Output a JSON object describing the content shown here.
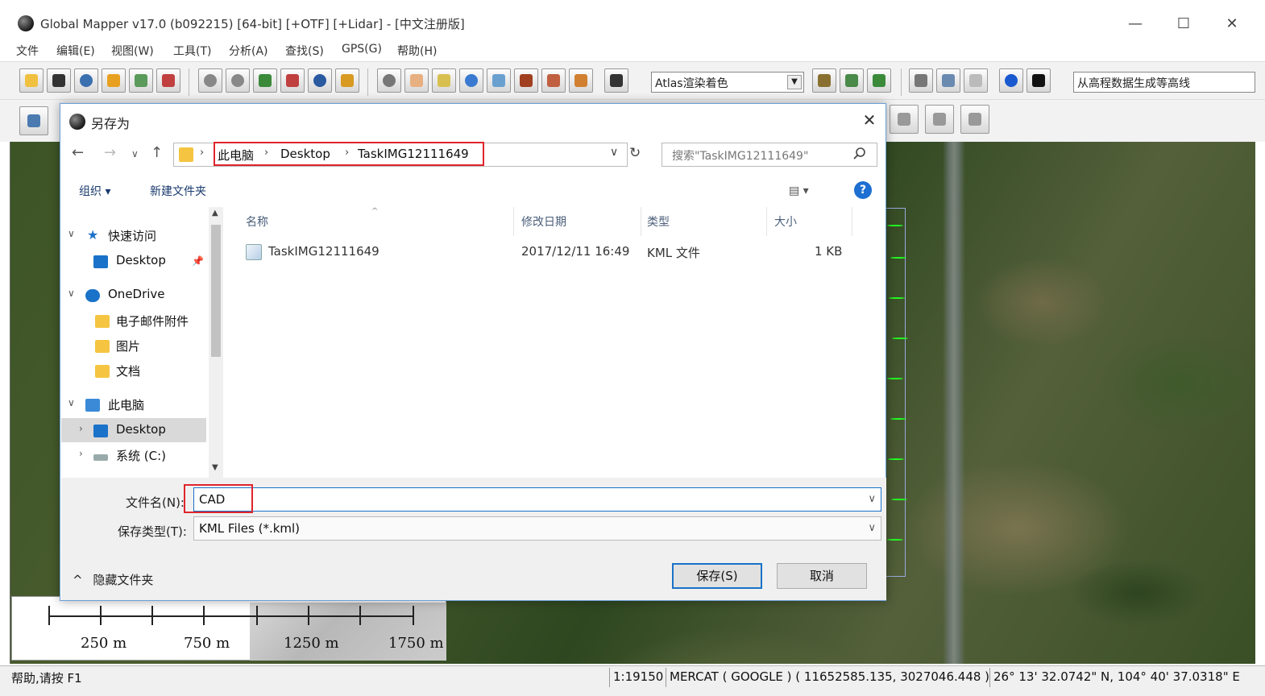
{
  "window": {
    "title": "Global Mapper v17.0 (b092215) [64-bit] [+OTF] [+Lidar] - [中文注册版]",
    "minimize": "—",
    "maximize": "☐",
    "close": "✕"
  },
  "menu": [
    "文件",
    "编辑(E)",
    "视图(W)",
    "工具(T)",
    "分析(A)",
    "查找(S)",
    "GPS(G)",
    "帮助(H)"
  ],
  "toolbar": {
    "shader_combo": "Atlas渲染着色",
    "contour_combo": "从高程数据生成等高线"
  },
  "dialog": {
    "title": "另存为",
    "breadcrumb": [
      "此电脑",
      "Desktop",
      "TaskIMG12111649"
    ],
    "search_placeholder": "搜索\"TaskIMG12111649\"",
    "commands": {
      "organize": "组织 ▾",
      "new_folder": "新建文件夹"
    },
    "nav": [
      {
        "label": "快速访问"
      },
      {
        "label": "Desktop"
      },
      {
        "label": "OneDrive"
      },
      {
        "label": "电子邮件附件"
      },
      {
        "label": "图片"
      },
      {
        "label": "文档"
      },
      {
        "label": "此电脑"
      },
      {
        "label": "Desktop"
      },
      {
        "label": "系统 (C:)"
      }
    ],
    "columns": {
      "name": "名称",
      "date": "修改日期",
      "type": "类型",
      "size": "大小"
    },
    "files": [
      {
        "name": "TaskIMG12111649",
        "date": "2017/12/11 16:49",
        "type": "KML 文件",
        "size": "1 KB"
      }
    ],
    "filename_label": "文件名(N):",
    "filename_value": "CAD",
    "filetype_label": "保存类型(T):",
    "filetype_value": "KML Files (*.kml)",
    "hide_folders": "隐藏文件夹",
    "save_button": "保存(S)",
    "cancel_button": "取消"
  },
  "scalebar": {
    "labels": [
      "250 m",
      "750 m",
      "1250 m",
      "1750 m"
    ]
  },
  "status": {
    "help": "帮助,请按 F1",
    "scale": "1:19150",
    "projection": "MERCAT ( GOOGLE ) ( 11652585.135, 3027046.448 )",
    "latlon": "26° 13' 32.0742\" N, 104° 40' 37.0318\" E"
  },
  "colors": {
    "highlight": "#e0242b",
    "accent": "#1a72c9"
  }
}
